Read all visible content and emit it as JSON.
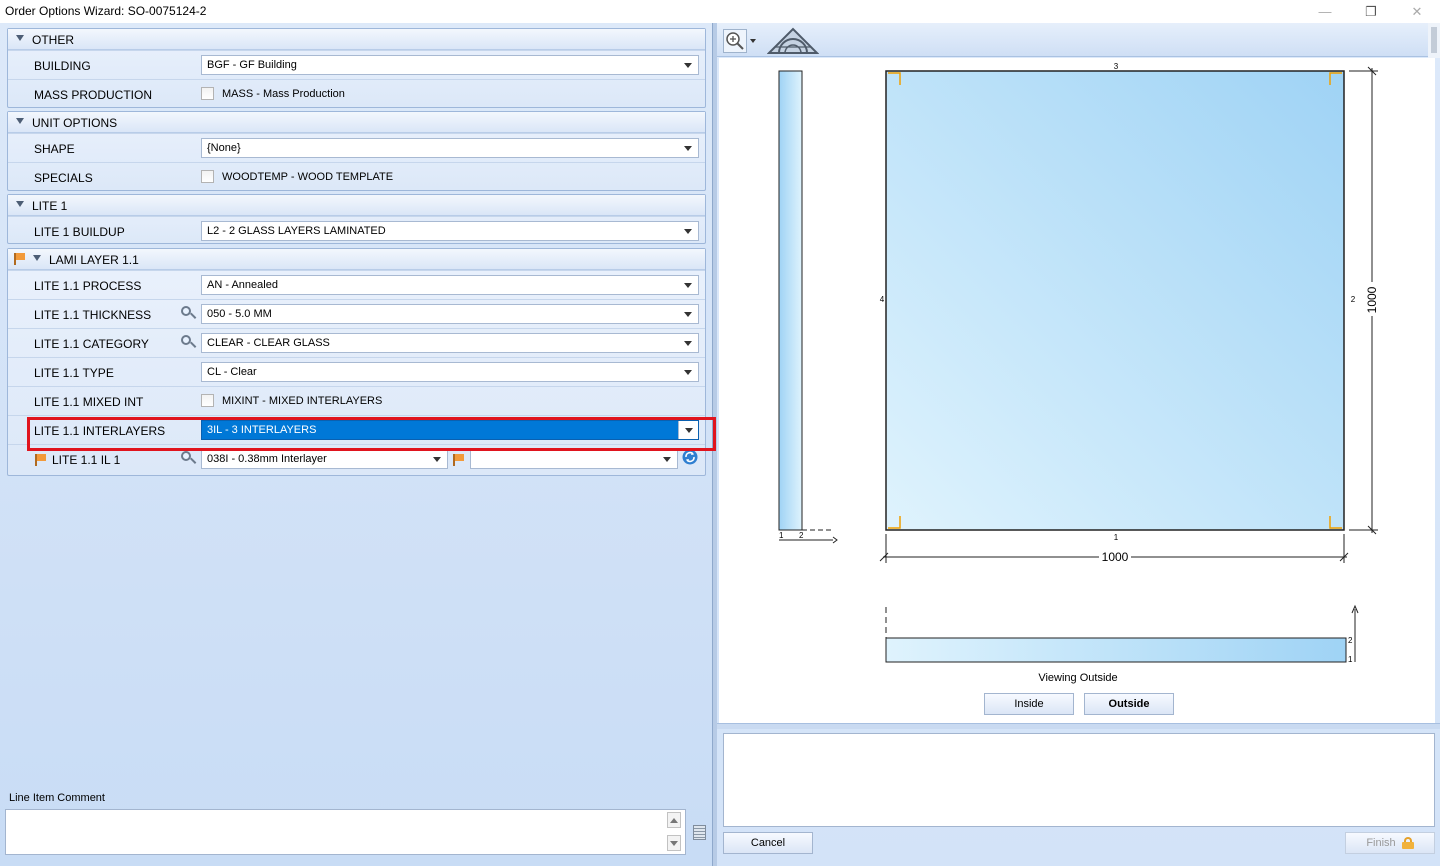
{
  "window": {
    "title": "Order Options Wizard: SO-0075124-2",
    "min_glyph": "—",
    "max_glyph": "❐",
    "close_glyph": "✕"
  },
  "groups": {
    "other": {
      "title": "OTHER",
      "building": {
        "label": "BUILDING",
        "value": "BGF - GF Building"
      },
      "mass_production": {
        "label": "MASS PRODUCTION",
        "checkbox_text": "MASS - Mass Production",
        "checked": false
      }
    },
    "unit_options": {
      "title": "UNIT OPTIONS",
      "shape": {
        "label": "SHAPE",
        "value": "{None}"
      },
      "specials": {
        "label": "SPECIALS",
        "checkbox_text": "WOODTEMP - WOOD TEMPLATE",
        "checked": false
      }
    },
    "lite1": {
      "title": "LITE 1",
      "buildup": {
        "label": "LITE 1 BUILDUP",
        "value": "L2 - 2 GLASS LAYERS LAMINATED"
      }
    },
    "lami_layer": {
      "title": "LAMI LAYER 1.1",
      "process": {
        "label": "LITE 1.1 PROCESS",
        "value": "AN - Annealed"
      },
      "thickness": {
        "label": "LITE 1.1 THICKNESS",
        "value": "050 - 5.0 MM"
      },
      "category": {
        "label": "LITE 1.1 CATEGORY",
        "value": "CLEAR - CLEAR GLASS"
      },
      "type": {
        "label": "LITE 1.1 TYPE",
        "value": "CL - Clear"
      },
      "mixed_int": {
        "label": "LITE 1.1 MIXED INT",
        "checkbox_text": "MIXINT - MIXED INTERLAYERS",
        "checked": false
      },
      "interlayers": {
        "label": "LITE 1.1 INTERLAYERS",
        "value": "3IL - 3 INTERLAYERS"
      },
      "il1": {
        "label": "LITE 1.1 IL 1",
        "value": "038I - 0.38mm Interlayer",
        "second_value": ""
      }
    }
  },
  "comment": {
    "label": "Line Item Comment",
    "value": ""
  },
  "drawing": {
    "dim_width": "1000",
    "dim_height": "1000",
    "edge_top": "3",
    "edge_right": "2",
    "edge_bottom": "1",
    "edge_left": "4",
    "side_labels": [
      "1",
      "2"
    ],
    "bottom_labels": [
      "2",
      "1"
    ],
    "viewing_caption": "Viewing Outside",
    "glass_color_light": "#dff3fd",
    "glass_color_dark": "#9fd3f5",
    "corner_color": "#f0a000"
  },
  "buttons": {
    "inside": "Inside",
    "outside": "Outside",
    "cancel": "Cancel",
    "finish": "Finish"
  },
  "icons": {
    "zoom": "zoom-icon",
    "house": "house-view-icon",
    "refresh": "refresh-icon",
    "lock": "lock-icon"
  }
}
